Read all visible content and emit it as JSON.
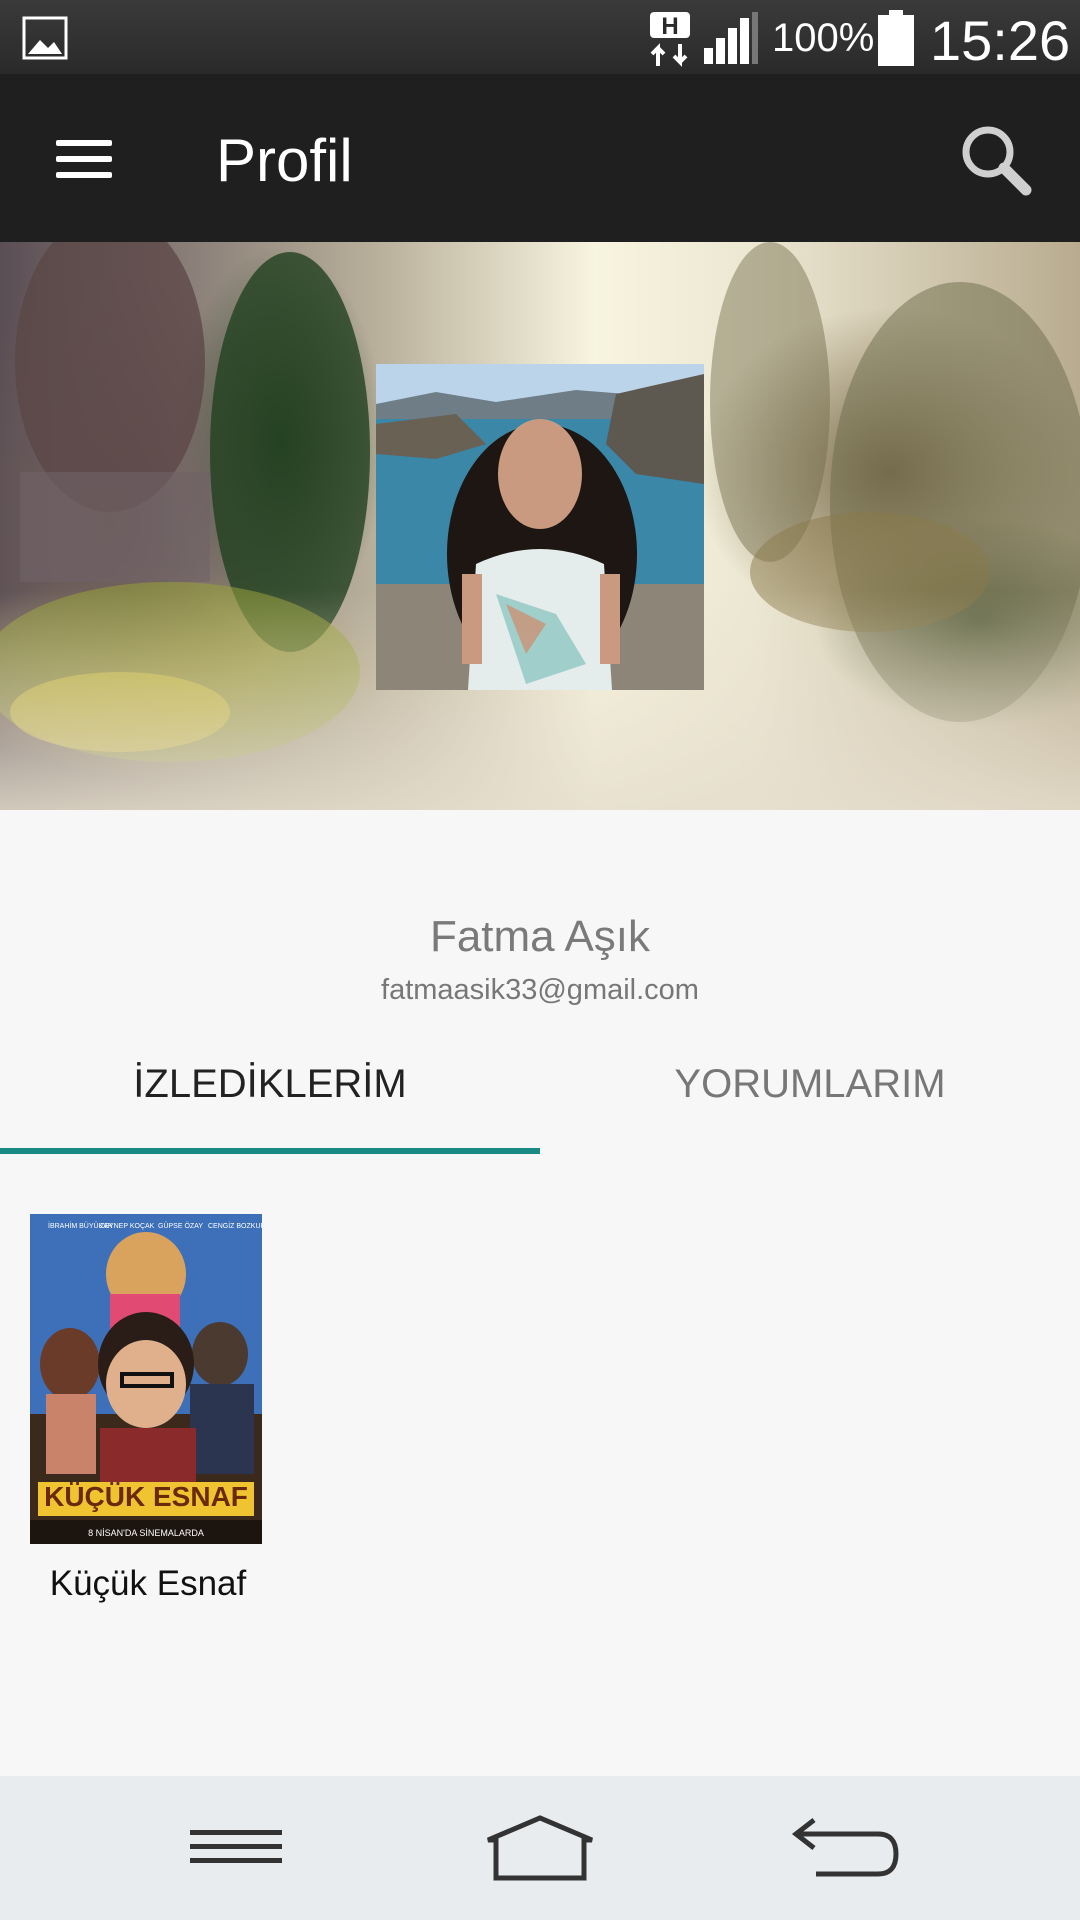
{
  "status_bar": {
    "battery_percent": "100%",
    "time": "15:26",
    "network_type": "H"
  },
  "app_bar": {
    "title": "Profil"
  },
  "profile": {
    "name": "Fatma Aşık",
    "email": "fatmaasik33@gmail.com"
  },
  "tabs": [
    {
      "label": "İZLEDİKLERİM",
      "active": true
    },
    {
      "label": "YORUMLARIM",
      "active": false
    }
  ],
  "colors": {
    "accent": "#1a8a85",
    "app_bar": "#1f1f1f"
  },
  "movies": [
    {
      "title": "Küçük Esnaf",
      "poster_text": "KÜÇÜK ESNAF",
      "poster_cast": [
        "İBRAHİM BÜYÜKAK",
        "ZEYNEP KOÇAK",
        "GÜPSE ÖZAY",
        "CENGİZ BOZKURT"
      ],
      "poster_release": "8 NİSAN'DA SİNEMALARDA"
    }
  ]
}
